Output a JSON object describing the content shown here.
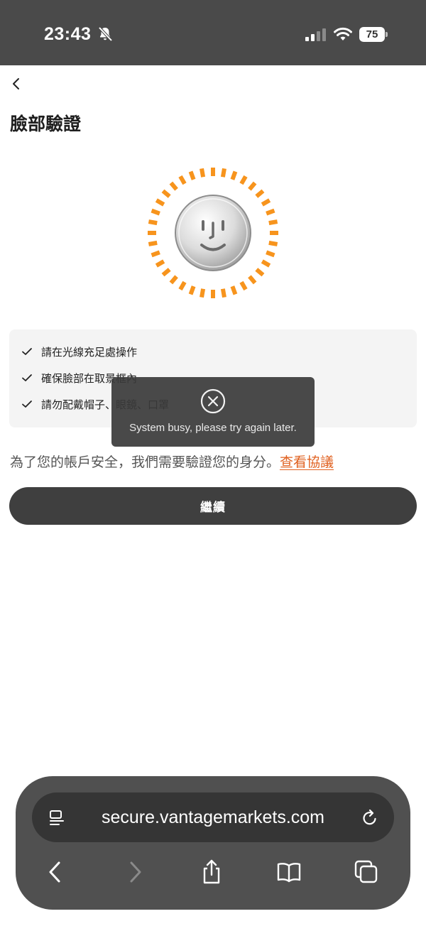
{
  "status": {
    "time": "23:43",
    "battery": "75"
  },
  "header": {
    "title": "臉部驗證"
  },
  "tips": [
    "請在光線充足處操作",
    "確保臉部在取景框內",
    "請勿配戴帽子、眼鏡、口罩"
  ],
  "agreement": {
    "text": "為了您的帳戶安全，我們需要驗證您的身分。",
    "link": "查看協議"
  },
  "continue_label": "繼續",
  "toast": {
    "message": "System busy, please try again later."
  },
  "browser": {
    "url": "secure.vantagemarkets.com"
  },
  "colors": {
    "accent": "#f7941d",
    "link": "#e0601f",
    "status_bar": "#4a4a4a",
    "button": "#3f3f3f"
  }
}
